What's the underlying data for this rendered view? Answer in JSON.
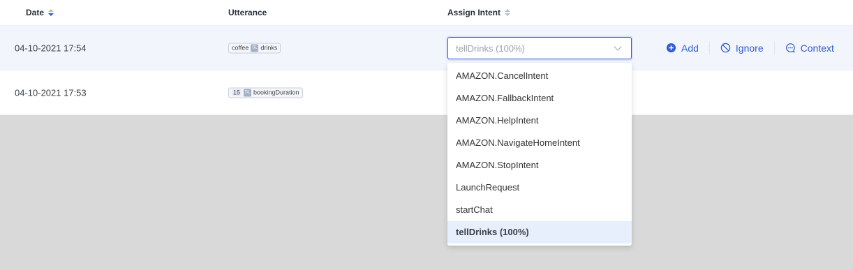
{
  "header": {
    "date": "Date",
    "utterance": "Utterance",
    "assign_intent": "Assign Intent"
  },
  "rows": [
    {
      "date": "04-10-2021 17:54",
      "utterance": {
        "text": "coffee",
        "slot_icon": "SL",
        "slot": "drinks"
      },
      "intent_value": "tellDrinks (100%)"
    },
    {
      "date": "04-10-2021 17:53",
      "utterance": {
        "text": "15",
        "slot_icon": "SL",
        "slot": "bookingDuration"
      }
    }
  ],
  "actions": {
    "add": "Add",
    "ignore": "Ignore",
    "context": "Context"
  },
  "dropdown": {
    "options": [
      "AMAZON.CancelIntent",
      "AMAZON.FallbackIntent",
      "AMAZON.HelpIntent",
      "AMAZON.NavigateHomeIntent",
      "AMAZON.StopIntent",
      "LaunchRequest",
      "startChat",
      "tellDrinks (100%)"
    ],
    "selected_index": 7
  },
  "colors": {
    "accent": "#2f5bd3",
    "selected_row": "#f3f5fc",
    "overlay": "#d9d9d9"
  }
}
